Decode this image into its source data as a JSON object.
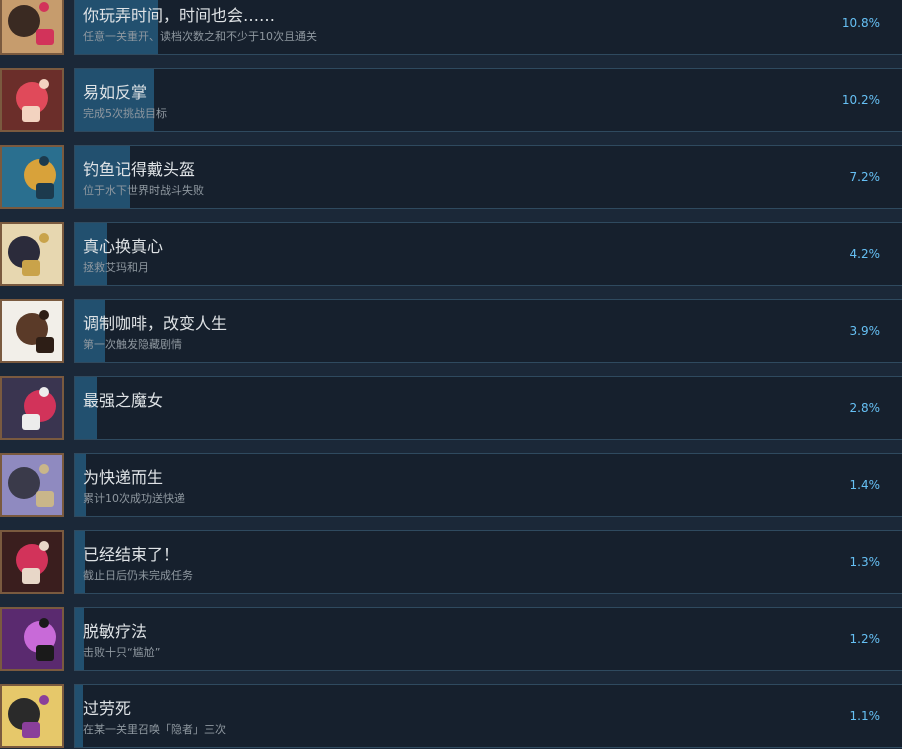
{
  "achievements": [
    {
      "title": "你玩弄时间，时间也会……",
      "description": "任意一关重开、读档次数之和不少于10次且通关",
      "percent": "10.8%",
      "fill": 10.8,
      "icon": "clock-girl-icon",
      "icon_colors": [
        "#c69c6d",
        "#3a2a22",
        "#d2335a"
      ]
    },
    {
      "title": "易如反掌",
      "description": "完成5次挑战目标",
      "percent": "10.2%",
      "fill": 10.2,
      "icon": "red-hair-girl-icon",
      "icon_colors": [
        "#6b2e2a",
        "#e04a5a",
        "#f3d3c0"
      ]
    },
    {
      "title": "钓鱼记得戴头盔",
      "description": "位于水下世界时战斗失败",
      "percent": "7.2%",
      "fill": 7.2,
      "icon": "diver-helmet-icon",
      "icon_colors": [
        "#2a6f8f",
        "#d8a23a",
        "#1c3a4d"
      ]
    },
    {
      "title": "真心换真心",
      "description": "拯救艾玛和月",
      "percent": "4.2%",
      "fill": 4.2,
      "icon": "two-girls-icon",
      "icon_colors": [
        "#e7d7b0",
        "#2b2b3b",
        "#c9a34a"
      ]
    },
    {
      "title": "调制咖啡，改变人生",
      "description": "第一次触发隐藏剧情",
      "percent": "3.9%",
      "fill": 3.9,
      "icon": "coffee-cup-icon",
      "icon_colors": [
        "#f2efe9",
        "#5a3a28",
        "#2d1e16"
      ]
    },
    {
      "title": "最强之魔女",
      "description": "",
      "percent": "2.8%",
      "fill": 2.8,
      "icon": "witch-icon",
      "icon_colors": [
        "#3a3550",
        "#d2335a",
        "#ececec"
      ]
    },
    {
      "title": "为快递而生",
      "description": "累计10次成功送快递",
      "percent": "1.4%",
      "fill": 1.4,
      "icon": "package-stack-icon",
      "icon_colors": [
        "#8f8ac0",
        "#3a3a4a",
        "#c9b68a"
      ]
    },
    {
      "title": "已经结束了！",
      "description": "截止日后仍未完成任务",
      "percent": "1.3%",
      "fill": 1.3,
      "icon": "girl-in-room-icon",
      "icon_colors": [
        "#3a1e1e",
        "#d2335a",
        "#e8d7c8"
      ]
    },
    {
      "title": "脱敏疗法",
      "description": "击败十只“尴尬”",
      "percent": "1.2%",
      "fill": 1.2,
      "icon": "monster-swarm-icon",
      "icon_colors": [
        "#5a2a6f",
        "#c86ad8",
        "#1a1a1a"
      ]
    },
    {
      "title": "过劳死",
      "description": "在某一关里召唤「隐者」三次",
      "percent": "1.1%",
      "fill": 1.1,
      "icon": "hermit-icon",
      "icon_colors": [
        "#e6c86a",
        "#2a2a2a",
        "#8a3f9a"
      ]
    }
  ]
}
